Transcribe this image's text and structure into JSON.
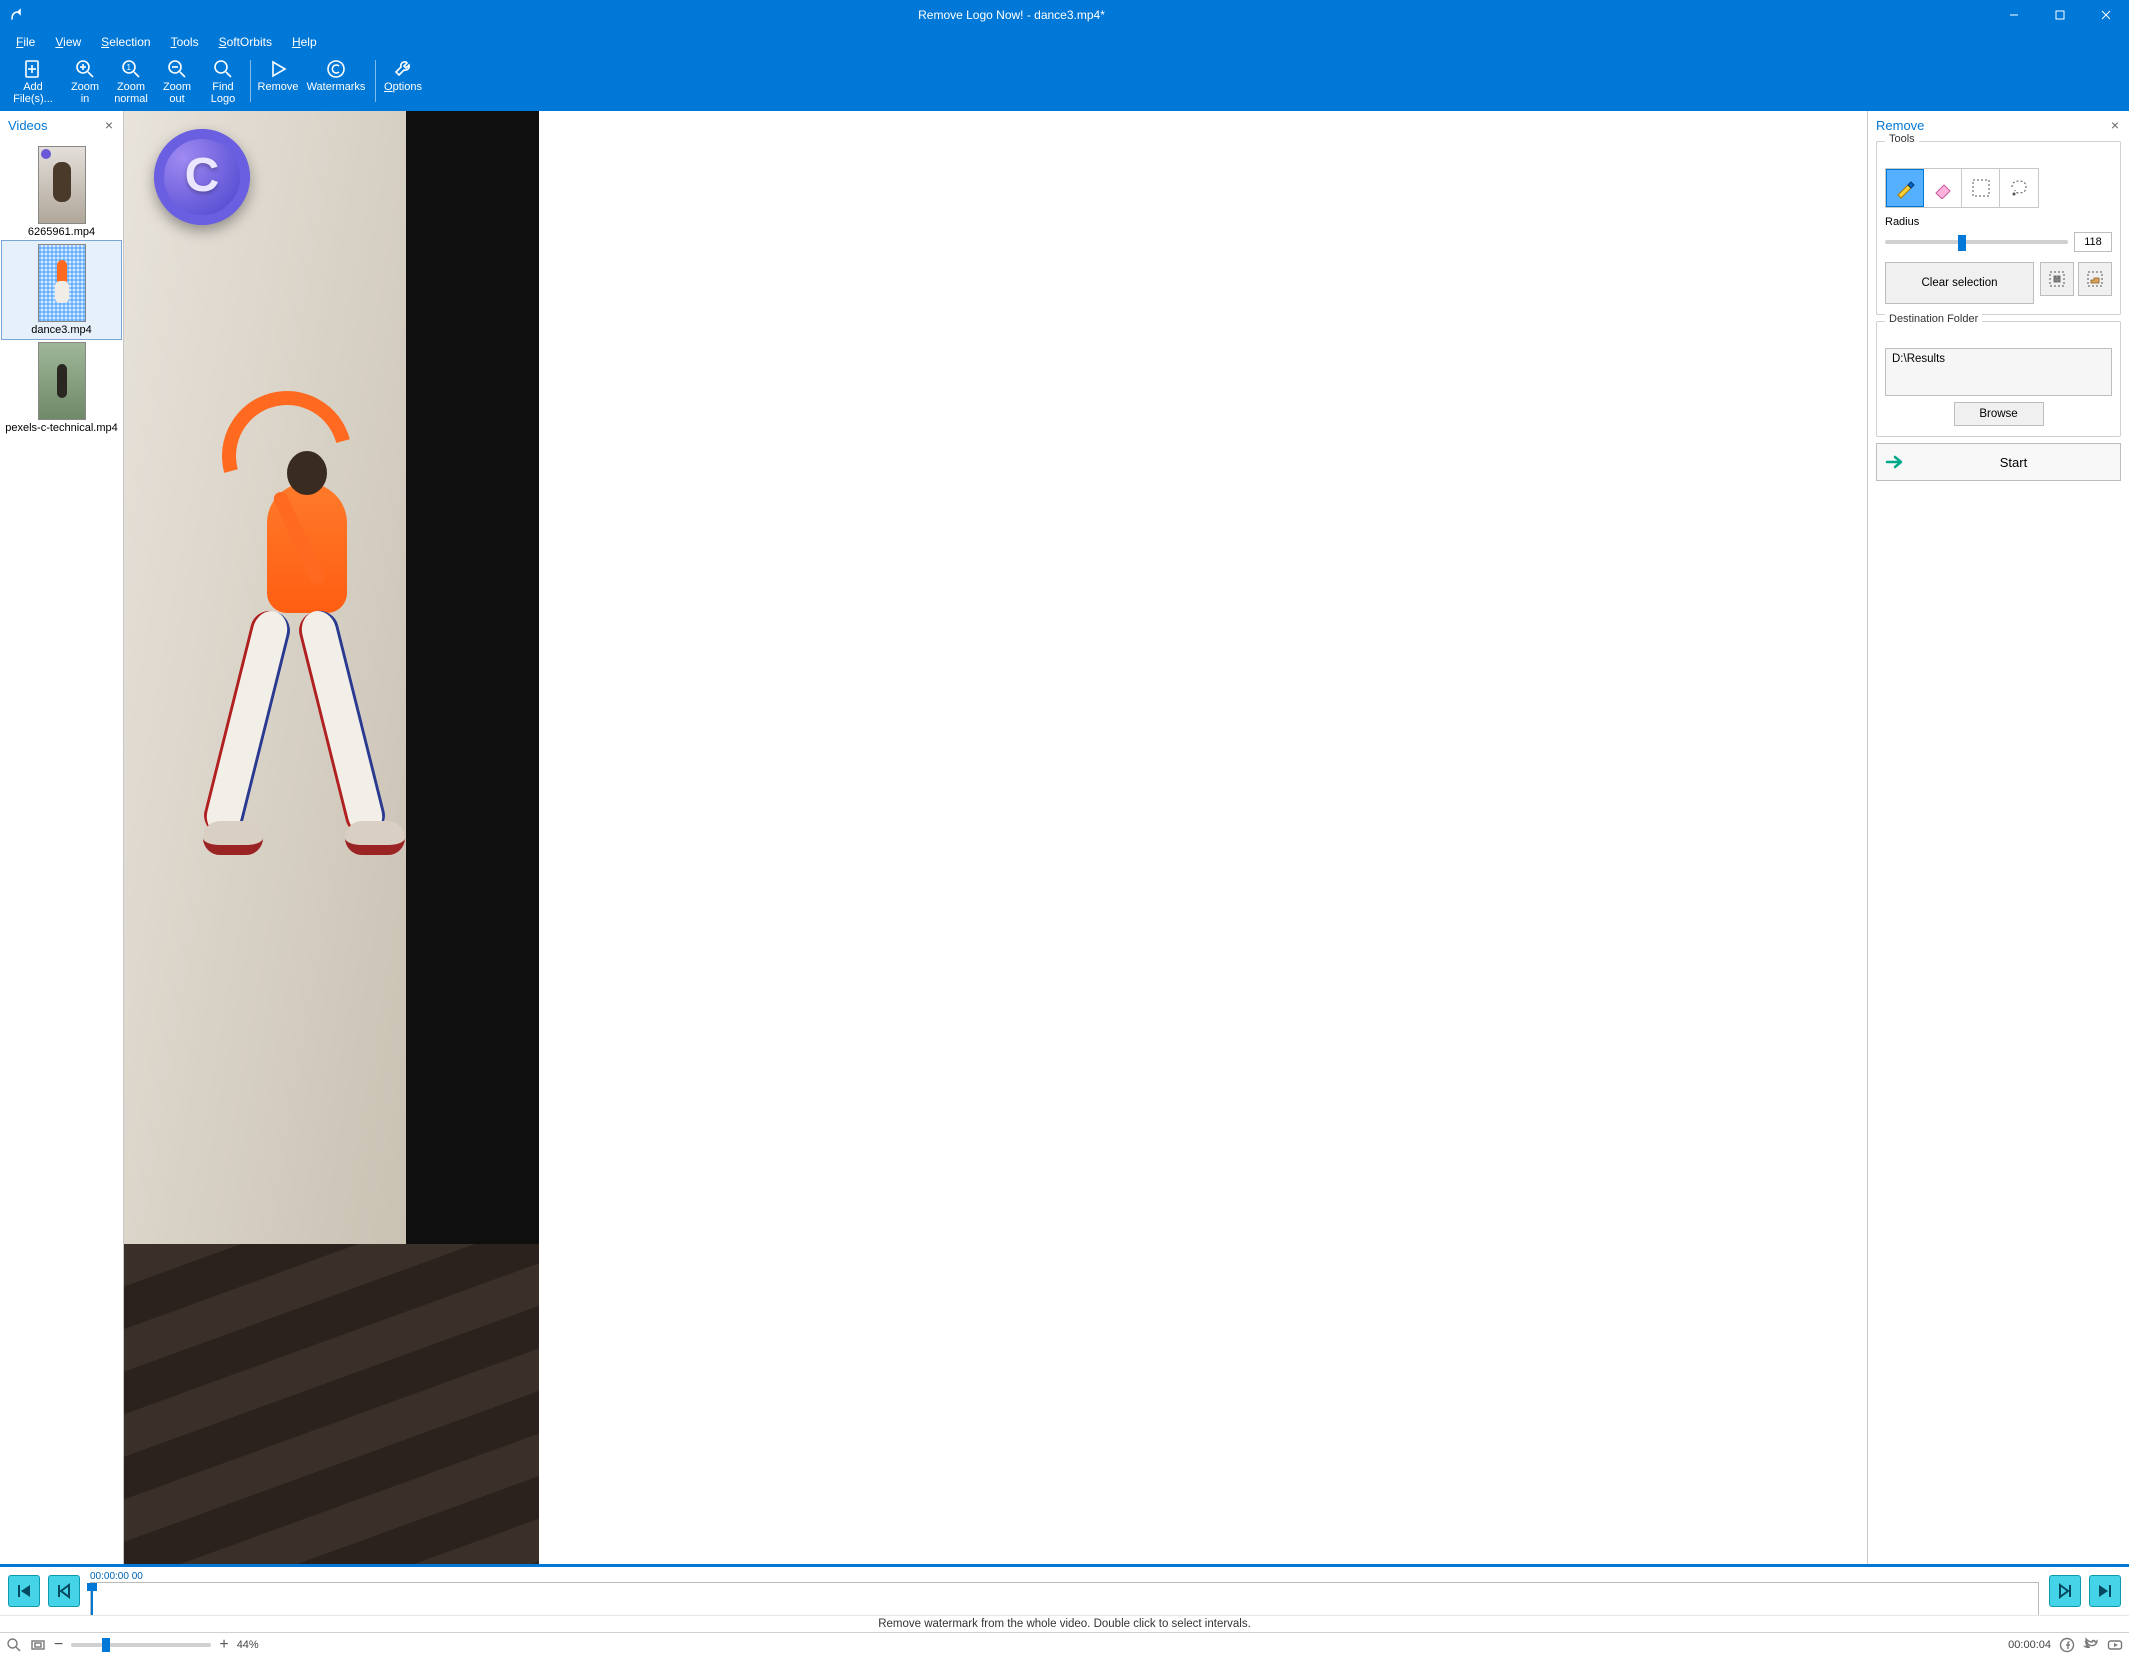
{
  "window": {
    "title": "Remove Logo Now! - dance3.mp4*"
  },
  "menu": {
    "items": [
      {
        "label": "File",
        "ul": "F"
      },
      {
        "label": "View",
        "ul": "V"
      },
      {
        "label": "Selection",
        "ul": "S"
      },
      {
        "label": "Tools",
        "ul": "T"
      },
      {
        "label": "SoftOrbits",
        "ul": "S"
      },
      {
        "label": "Help",
        "ul": "H"
      }
    ]
  },
  "toolbar": {
    "add_files": "Add\nFile(s)...",
    "zoom_in": "Zoom\nin",
    "zoom_normal": "Zoom\nnormal",
    "zoom_out": "Zoom\nout",
    "find_logo": "Find\nLogo",
    "remove": "Remove",
    "watermarks": "Watermarks",
    "options": "Options"
  },
  "videos_pane": {
    "title": "Videos",
    "close": "×",
    "items": [
      {
        "name": "6265961.mp4"
      },
      {
        "name": "dance3.mp4"
      },
      {
        "name": "pexels-c-technical.mp4"
      }
    ]
  },
  "remove_pane": {
    "title": "Remove",
    "close": "×",
    "tools_label": "Tools",
    "radius_label": "Radius",
    "radius_value": "118",
    "clear_selection": "Clear selection",
    "dest_label": "Destination Folder",
    "dest_value": "D:\\Results",
    "browse": "Browse",
    "start": "Start"
  },
  "timeline": {
    "time_current": "00:00:00 00",
    "help": "Remove watermark from the whole video. Double click to select intervals."
  },
  "statusbar": {
    "zoom_percent": "44%",
    "duration": "00:00:04"
  }
}
